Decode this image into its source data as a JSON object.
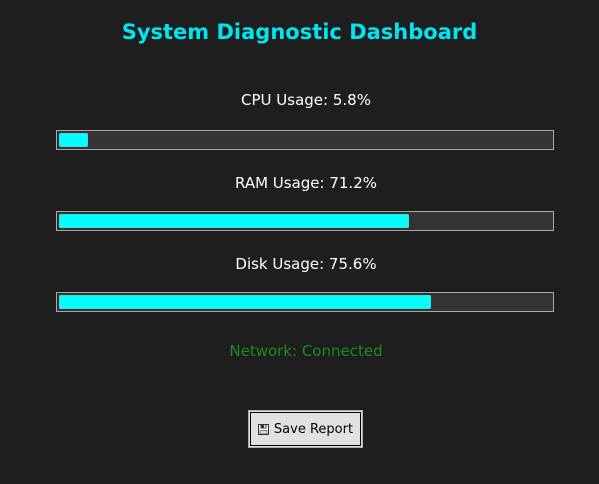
{
  "title": "System Diagnostic Dashboard",
  "metrics": [
    {
      "label": "CPU Usage: 5.8%",
      "value": 5.8
    },
    {
      "label": "RAM Usage: 71.2%",
      "value": 71.2
    },
    {
      "label": "Disk Usage: 75.6%",
      "value": 75.6
    }
  ],
  "network": {
    "label": "Network: Connected"
  },
  "save_button": {
    "label": "Save Report",
    "icon": "floppy-disk-icon"
  },
  "colors": {
    "background": "#1e1e1e",
    "title": "#00e5ee",
    "bar_fill": "#00ffff",
    "bar_track": "#333333",
    "network_connected": "#1c8c1c"
  }
}
